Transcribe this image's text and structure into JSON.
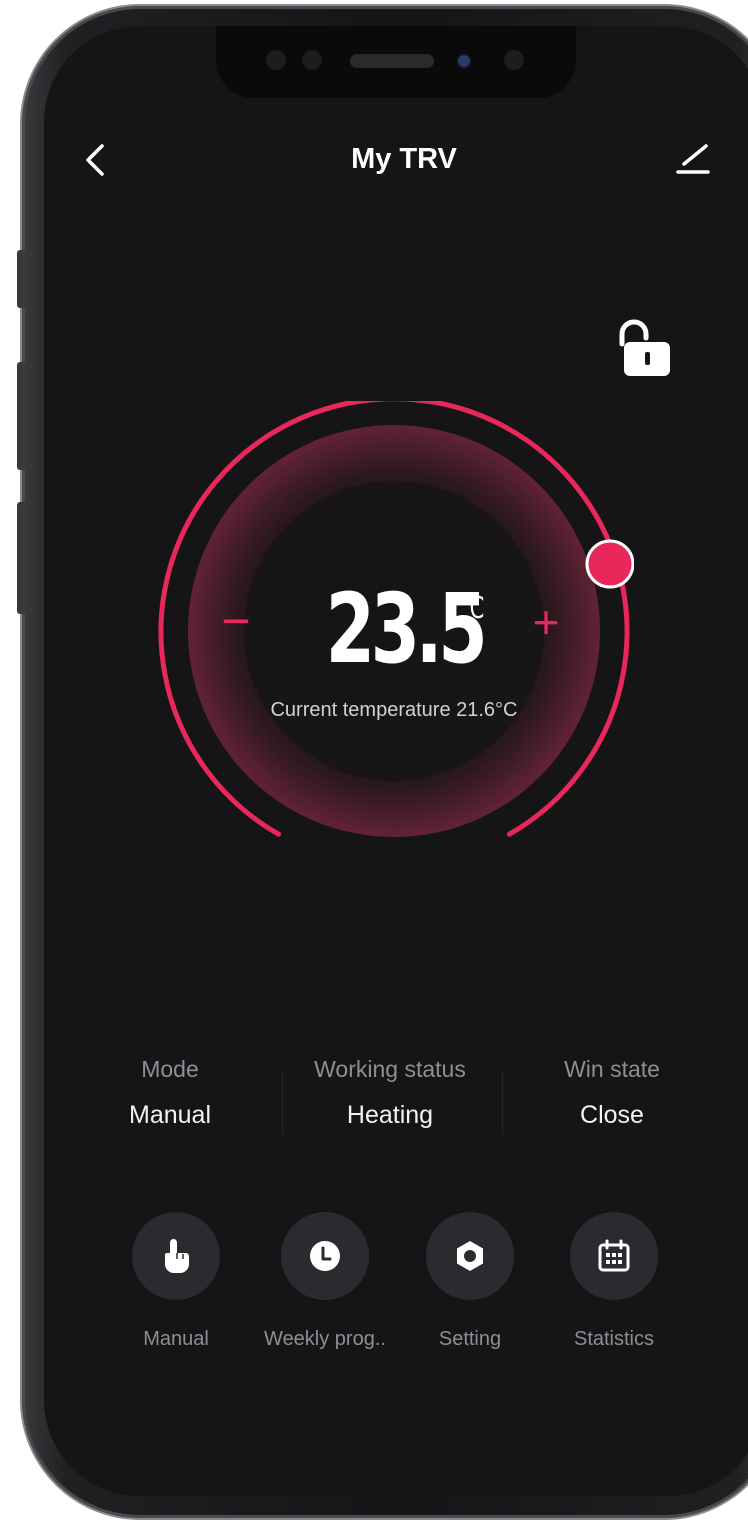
{
  "header": {
    "title": "My TRV",
    "back_icon": "chevron-left-icon",
    "edit_icon": "pencil-icon"
  },
  "lock": {
    "icon": "unlocked-padlock-icon",
    "state": "unlocked"
  },
  "thermostat": {
    "setpoint": "23.5",
    "unit": "℃",
    "current_temperature_text": "Current temperature 21.6°C",
    "minus_label": "−",
    "plus_label": "+",
    "accent_color": "#e8285a",
    "knob_color": "#e8285a"
  },
  "status": [
    {
      "label": "Mode",
      "value": "Manual"
    },
    {
      "label": "Working status",
      "value": "Heating"
    },
    {
      "label": "Win state",
      "value": "Close"
    }
  ],
  "actions": [
    {
      "label": "Manual",
      "icon": "hand-pointer-icon"
    },
    {
      "label": "Weekly prog..",
      "icon": "clock-icon"
    },
    {
      "label": "Setting",
      "icon": "hexagon-nut-icon"
    },
    {
      "label": "Statistics",
      "icon": "calendar-icon"
    }
  ],
  "colors": {
    "background": "#151517",
    "accent": "#e8285a",
    "text_primary": "#ffffff",
    "text_secondary": "#8e8e93",
    "button_background": "#2b2b2f"
  }
}
